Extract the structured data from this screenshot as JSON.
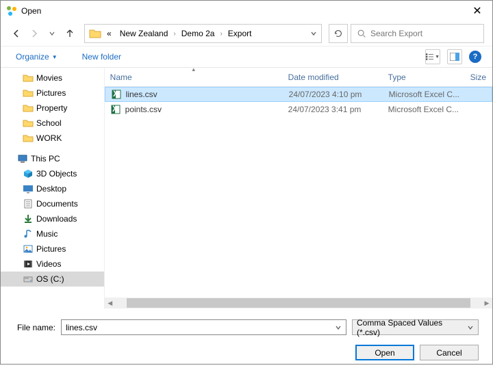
{
  "window": {
    "title": "Open"
  },
  "nav": {
    "breadcrumbs_prefix": "«",
    "crumbs": [
      "New Zealand",
      "Demo 2a",
      "Export"
    ],
    "search_placeholder": "Search Export"
  },
  "toolbar": {
    "organize": "Organize",
    "new_folder": "New folder"
  },
  "tree": {
    "items": [
      {
        "label": "Movies",
        "icon": "folder",
        "level": 2
      },
      {
        "label": "Pictures",
        "icon": "folder",
        "level": 2
      },
      {
        "label": "Property",
        "icon": "folder",
        "level": 2
      },
      {
        "label": "School",
        "icon": "folder",
        "level": 2
      },
      {
        "label": "WORK",
        "icon": "folder",
        "level": 2
      },
      {
        "label": "This PC",
        "icon": "pc",
        "level": 1,
        "gap": true
      },
      {
        "label": "3D Objects",
        "icon": "3d",
        "level": 2
      },
      {
        "label": "Desktop",
        "icon": "desktop",
        "level": 2
      },
      {
        "label": "Documents",
        "icon": "documents",
        "level": 2
      },
      {
        "label": "Downloads",
        "icon": "downloads",
        "level": 2
      },
      {
        "label": "Music",
        "icon": "music",
        "level": 2
      },
      {
        "label": "Pictures",
        "icon": "pictures",
        "level": 2
      },
      {
        "label": "Videos",
        "icon": "videos",
        "level": 2
      },
      {
        "label": "OS (C:)",
        "icon": "drive",
        "level": 2,
        "selected": true
      }
    ]
  },
  "files": {
    "headers": {
      "name": "Name",
      "date": "Date modified",
      "type": "Type",
      "size": "Size"
    },
    "rows": [
      {
        "name": "lines.csv",
        "date": "24/07/2023 4:10 pm",
        "type": "Microsoft Excel C...",
        "selected": true
      },
      {
        "name": "points.csv",
        "date": "24/07/2023 3:41 pm",
        "type": "Microsoft Excel C...",
        "selected": false
      }
    ]
  },
  "footer": {
    "file_name_label": "File name:",
    "file_name_value": "lines.csv",
    "file_type": "Comma Spaced Values (*.csv)",
    "open": "Open",
    "cancel": "Cancel"
  }
}
